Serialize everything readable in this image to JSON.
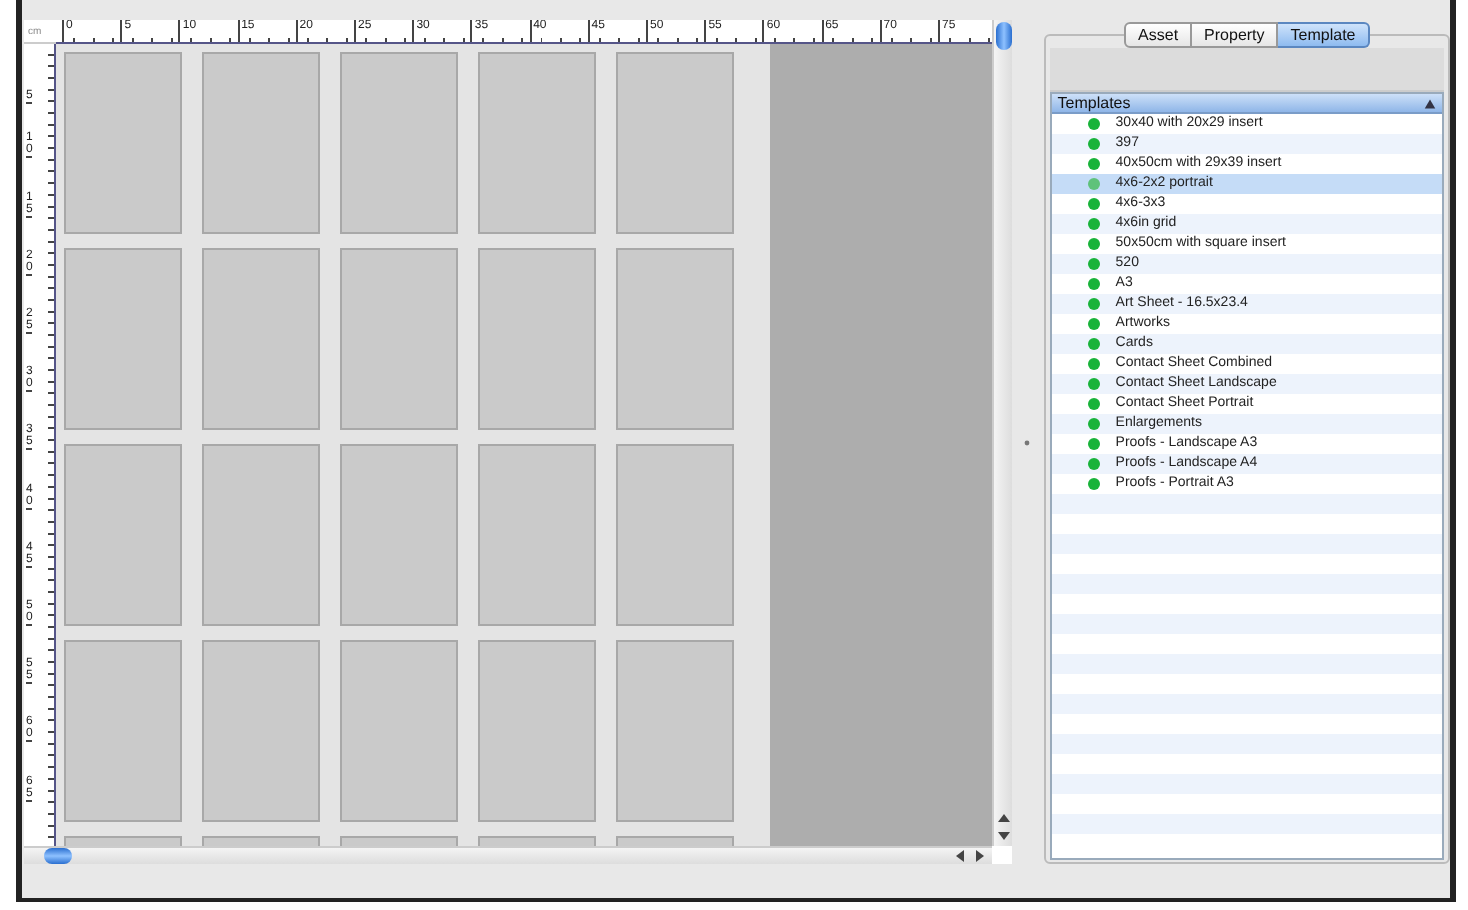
{
  "ruler": {
    "unit": "cm",
    "top_labels": [
      "0",
      "5",
      "10",
      "15",
      "20",
      "25",
      "30",
      "35",
      "40",
      "45",
      "50",
      "55",
      "60",
      "65",
      "70",
      "75"
    ],
    "left_labels": [
      "5",
      "10",
      "15",
      "20",
      "25",
      "30",
      "35",
      "40",
      "45",
      "50",
      "55",
      "60",
      "65"
    ]
  },
  "tabs": [
    {
      "label": "Asset",
      "selected": false
    },
    {
      "label": "Property",
      "selected": false
    },
    {
      "label": "Template",
      "selected": true
    }
  ],
  "templates": {
    "header": "Templates",
    "items": [
      {
        "name": "30x40 with 20x29 insert",
        "selected": false
      },
      {
        "name": "397",
        "selected": false
      },
      {
        "name": "40x50cm with 29x39 insert",
        "selected": false
      },
      {
        "name": "4x6-2x2 portrait",
        "selected": true
      },
      {
        "name": "4x6-3x3",
        "selected": false
      },
      {
        "name": "4x6in grid",
        "selected": false
      },
      {
        "name": "50x50cm with square insert",
        "selected": false
      },
      {
        "name": "520",
        "selected": false
      },
      {
        "name": "A3",
        "selected": false
      },
      {
        "name": "Art Sheet - 16.5x23.4",
        "selected": false
      },
      {
        "name": "Artworks",
        "selected": false
      },
      {
        "name": "Cards",
        "selected": false
      },
      {
        "name": "Contact Sheet Combined",
        "selected": false
      },
      {
        "name": "Contact Sheet Landscape",
        "selected": false
      },
      {
        "name": "Contact Sheet Portrait",
        "selected": false
      },
      {
        "name": "Enlargements",
        "selected": false
      },
      {
        "name": "Proofs - Landscape A3",
        "selected": false
      },
      {
        "name": "Proofs - Landscape A4",
        "selected": false
      },
      {
        "name": "Proofs - Portrait A3",
        "selected": false
      }
    ]
  }
}
